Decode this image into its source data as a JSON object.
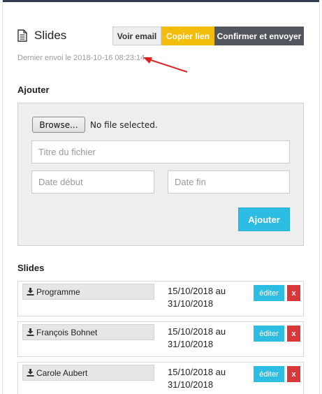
{
  "header": {
    "title": "Slides",
    "buttons": {
      "voir_email": "Voir email",
      "copier_lien": "Copier lien",
      "confirmer": "Confirmer et envoyer"
    },
    "last_sent": "Dernier envoi le 2018-10-16 08:23:14"
  },
  "add_section": {
    "title": "Ajouter",
    "browse_label": "Browse...",
    "no_file": "No file selected.",
    "file_title_placeholder": "Titre du fichier",
    "start_date_placeholder": "Date début",
    "end_date_placeholder": "Date fin",
    "submit_label": "Ajouter"
  },
  "slides_section": {
    "title": "Slides",
    "items": [
      {
        "name": "Programme",
        "dates": "15/10/2018 au 31/10/2018",
        "edit_label": "éditer",
        "delete_label": "x"
      },
      {
        "name": "François Bohnet",
        "dates": "15/10/2018 au 31/10/2018",
        "edit_label": "éditer",
        "delete_label": "x"
      },
      {
        "name": "Carole Aubert",
        "dates": "15/10/2018 au 31/10/2018",
        "edit_label": "éditer",
        "delete_label": "x"
      }
    ]
  },
  "colors": {
    "accent_yellow": "#f2be0b",
    "accent_blue": "#2dbde3",
    "dark_button": "#51565d",
    "danger": "#d9383a",
    "annotation_arrow": "#e02020"
  },
  "icons": {
    "title": "file-text-icon",
    "file": "download-icon",
    "annotation": "red-arrow-annotation"
  }
}
